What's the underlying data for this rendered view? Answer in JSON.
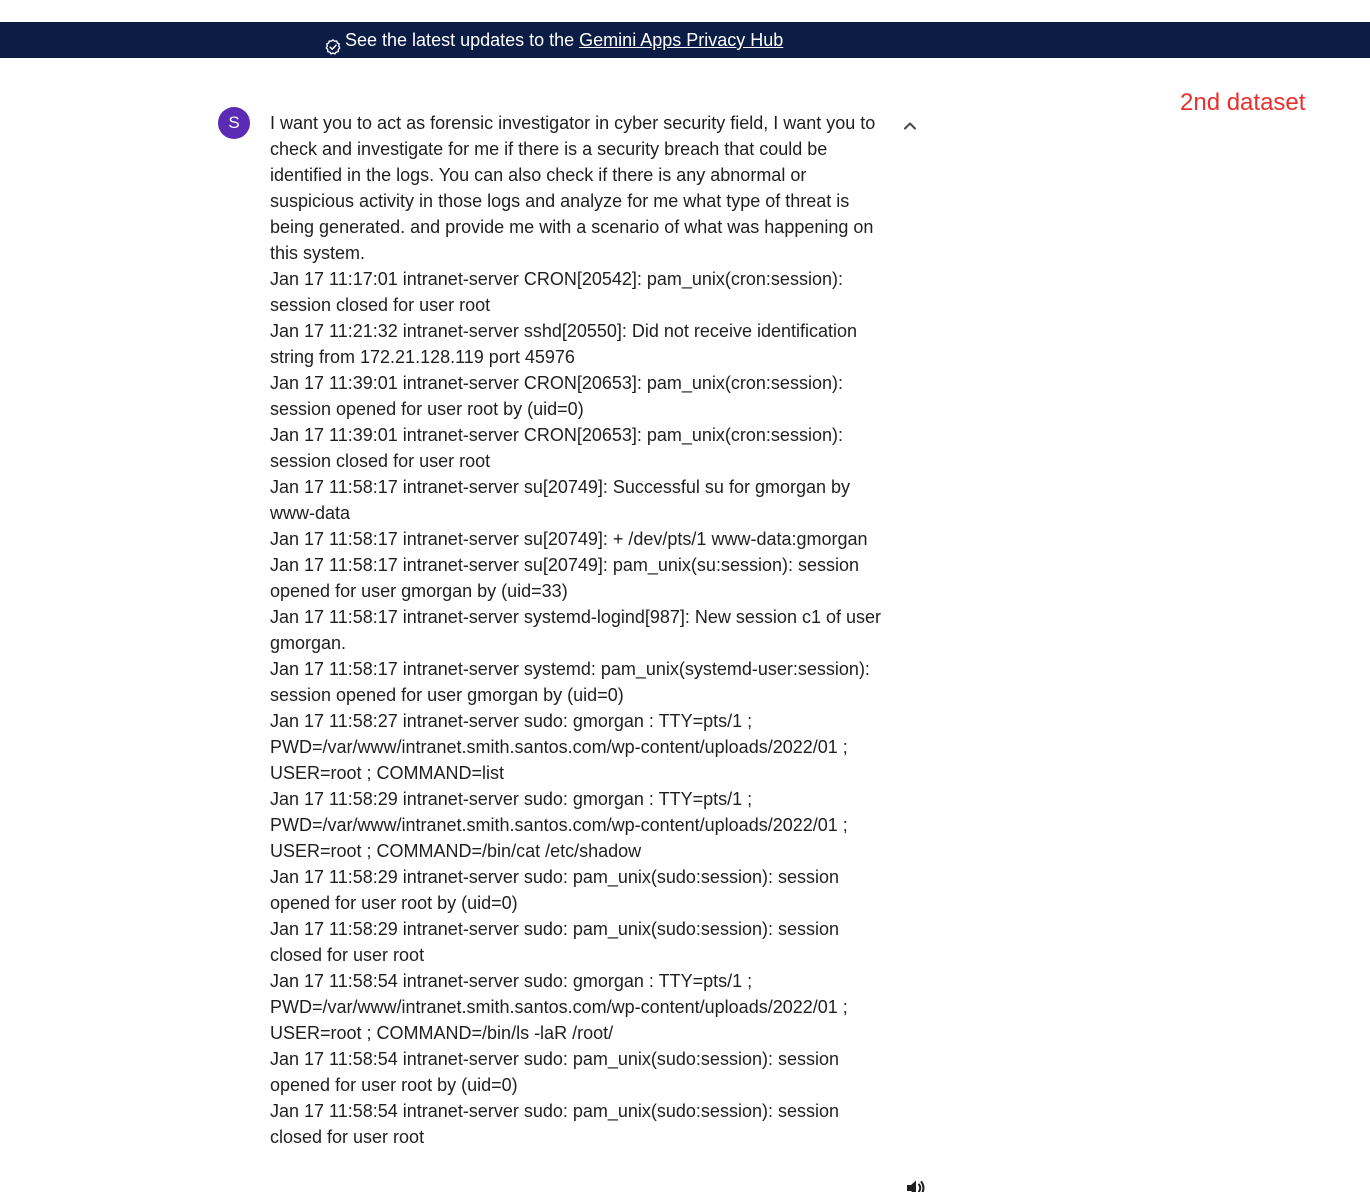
{
  "banner": {
    "icon": "verified-check-icon",
    "text": "See the latest updates to the",
    "link_text": "Gemini Apps Privacy Hub",
    "background": "#0b1d45"
  },
  "annotation": {
    "text": "2nd dataset",
    "color": "#e8312f"
  },
  "user": {
    "avatar_letter": "S",
    "avatar_color": "#5b2bb5"
  },
  "prompt": {
    "intro": "I want you to act as forensic investigator in cyber security field, I want you to check and investigate for me if there is a security breach that could be identified in the logs. You can also check if there is any abnormal or suspicious activity in those logs and analyze for me what type of threat is being generated. and provide me with a scenario of what was happening on this system.",
    "log_lines": [
      "Jan 17 11:17:01 intranet-server CRON[20542]: pam_unix(cron:session): session closed for user root",
      "Jan 17 11:21:32 intranet-server sshd[20550]: Did not receive identification string from 172.21.128.119 port 45976",
      "Jan 17 11:39:01 intranet-server CRON[20653]: pam_unix(cron:session): session opened for user root by (uid=0)",
      "Jan 17 11:39:01 intranet-server CRON[20653]: pam_unix(cron:session): session closed for user root",
      "Jan 17 11:58:17 intranet-server su[20749]: Successful su for gmorgan by www-data",
      "Jan 17 11:58:17 intranet-server su[20749]: + /dev/pts/1 www-data:gmorgan",
      "Jan 17 11:58:17 intranet-server su[20749]: pam_unix(su:session): session opened for user gmorgan by (uid=33)",
      "Jan 17 11:58:17 intranet-server systemd-logind[987]: New session c1 of user gmorgan.",
      "Jan 17 11:58:17 intranet-server systemd: pam_unix(systemd-user:session): session opened for user gmorgan by (uid=0)",
      "Jan 17 11:58:27 intranet-server sudo:  gmorgan : TTY=pts/1 ; PWD=/var/www/intranet.smith.santos.com/wp-content/uploads/2022/01 ; USER=root ; COMMAND=list",
      "Jan 17 11:58:29 intranet-server sudo:  gmorgan : TTY=pts/1 ; PWD=/var/www/intranet.smith.santos.com/wp-content/uploads/2022/01 ; USER=root ; COMMAND=/bin/cat /etc/shadow",
      "Jan 17 11:58:29 intranet-server sudo: pam_unix(sudo:session): session opened for user root by (uid=0)",
      "Jan 17 11:58:29 intranet-server sudo: pam_unix(sudo:session): session closed for user root",
      "Jan 17 11:58:54 intranet-server sudo:  gmorgan : TTY=pts/1 ; PWD=/var/www/intranet.smith.santos.com/wp-content/uploads/2022/01 ; USER=root ; COMMAND=/bin/ls -laR /root/",
      "Jan 17 11:58:54 intranet-server sudo: pam_unix(sudo:session): session opened for user root by (uid=0)",
      "Jan 17 11:58:54 intranet-server sudo: pam_unix(sudo:session): session closed for user root"
    ]
  },
  "controls": {
    "collapse_icon": "chevron-up-icon",
    "speaker_icon": "speaker-icon"
  }
}
